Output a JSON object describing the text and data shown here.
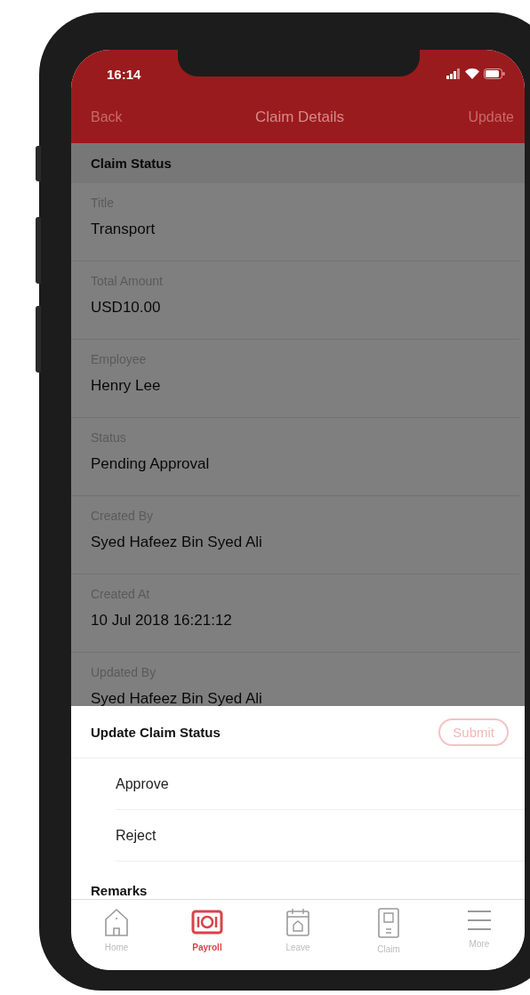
{
  "status_bar": {
    "time": "16:14"
  },
  "nav_bar": {
    "back": "Back",
    "title": "Claim Details",
    "action": "Update"
  },
  "section": {
    "title": "Claim Status"
  },
  "fields": [
    {
      "label": "Title",
      "value": "Transport"
    },
    {
      "label": "Total Amount",
      "value": "USD10.00"
    },
    {
      "label": "Employee",
      "value": "Henry Lee"
    },
    {
      "label": "Status",
      "value": "Pending Approval"
    },
    {
      "label": "Created By",
      "value": "Syed Hafeez Bin Syed Ali"
    },
    {
      "label": "Created At",
      "value": "10 Jul 2018 16:21:12"
    },
    {
      "label": "Updated By",
      "value": "Syed Hafeez Bin Syed Ali"
    }
  ],
  "sheet": {
    "title": "Update Claim Status",
    "submit": "Submit",
    "options": [
      "Approve",
      "Reject"
    ],
    "next_heading": "Remarks"
  },
  "tab_bar": [
    {
      "kind": "home",
      "label": "Home",
      "selected": false
    },
    {
      "kind": "payroll",
      "label": "Payroll",
      "selected": true
    },
    {
      "kind": "leave",
      "label": "Leave",
      "selected": false
    },
    {
      "kind": "claim",
      "label": "Claim",
      "selected": false
    },
    {
      "kind": "more",
      "label": "More",
      "selected": false
    }
  ]
}
